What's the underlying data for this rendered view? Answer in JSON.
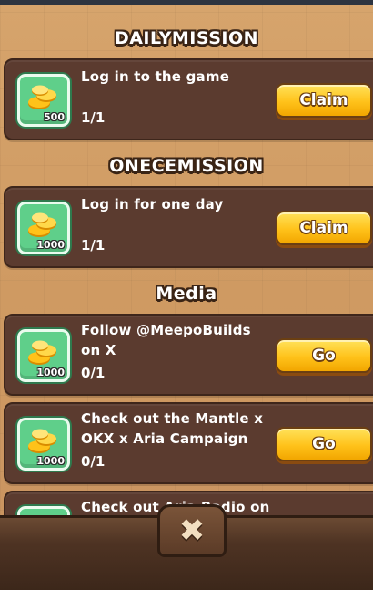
{
  "sections": {
    "daily": {
      "title": "DAILYMISSION"
    },
    "once": {
      "title": "ONECEMISSION"
    },
    "media": {
      "title": "Media"
    }
  },
  "missions": [
    {
      "title": "Log in to the game",
      "progress": "1/1",
      "reward_amount": "500",
      "button_label": "Claim",
      "reward_icon": "gold-coins-icon"
    },
    {
      "title": "Log in for one day",
      "progress": "1/1",
      "reward_amount": "1000",
      "button_label": "Claim",
      "reward_icon": "gold-coins-icon"
    },
    {
      "title": "Follow @MeepoBuilds on X",
      "progress": "0/1",
      "reward_amount": "1000",
      "button_label": "Go",
      "reward_icon": "gold-coins-icon"
    },
    {
      "title": "Check out the Mantle x OKX x Aria Campaign",
      "progress": "0/1",
      "reward_amount": "1000",
      "button_label": "Go",
      "reward_icon": "gold-coins-icon"
    },
    {
      "title": "Check out Aria Radio on",
      "reward_icon": "gold-coins-icon"
    }
  ],
  "footer": {
    "close_icon": "close-icon",
    "close_glyph": "✖"
  },
  "colors": {
    "card": "#5b3b2f",
    "tile": "#5fcf8a",
    "button": "#ffc21a",
    "background": "#d6a46c"
  }
}
